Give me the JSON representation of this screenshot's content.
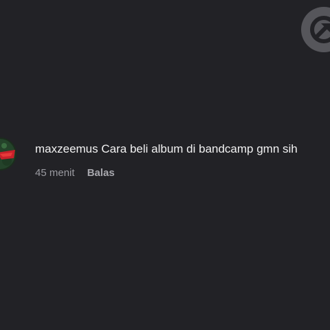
{
  "comment": {
    "username": "maxzeemus",
    "text": "Cara beli album di bandcamp gmn sih",
    "timestamp": "45 menit",
    "reply_label": "Balas"
  },
  "share_badge": {
    "icon": "share-arrow-icon"
  },
  "avatar": {
    "icon": "user-avatar-image"
  },
  "colors": {
    "background": "#222226",
    "text_primary": "#f2f2f2",
    "text_secondary": "#9b9ba1",
    "badge": "#56565b"
  }
}
